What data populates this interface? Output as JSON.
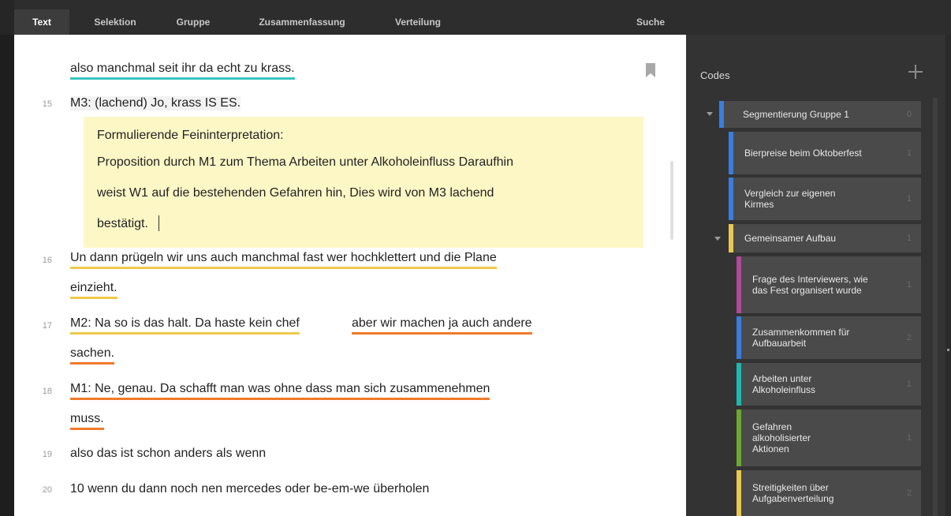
{
  "tabs": {
    "text": "Text",
    "selektion": "Selektion",
    "gruppe": "Gruppe",
    "zusammenfassung": "Zusammenfassung",
    "verteilung": "Verteilung",
    "suche": "Suche"
  },
  "transcript": {
    "line_prev": "also manchmal seit ihr da echt zu krass.",
    "line15_num": "15",
    "line15": "M3: (lachend) Jo, krass IS ES.",
    "memo_title": "Formulierende Feininterpretation:",
    "memo_line1": "Proposition durch M1 zum Thema Arbeiten unter Alkoholeinfluss Daraufhin",
    "memo_line2": "weist W1 auf die bestehenden Gefahren hin, Dies wird von M3 lachend",
    "memo_line3": "bestätigt.",
    "line16_num": "16",
    "line16a": "Un dann prügeln wir uns auch manchmal fast wer hochklettert und die Plane",
    "line16b": "einzieht.",
    "line17_num": "17",
    "line17a_part1": "M2: Na so is das halt. Da haste kein chef",
    "line17a_part2": "aber wir machen ja auch andere",
    "line17b": "sachen.",
    "line18_num": "18",
    "line18a": "M1: Ne, genau. Da schafft man was ohne dass man sich zusammenehmen",
    "line18b": "muss.",
    "line19_num": "19",
    "line19": "also das ist schon anders als wenn",
    "line20_num": "20",
    "line20": "10 wenn du dann noch nen mercedes oder be-em-we überholen"
  },
  "codes": {
    "title": "Codes",
    "items": [
      {
        "label": "Segmentierung Gruppe 1",
        "count": "0",
        "color": "#3a7de0"
      },
      {
        "label": "Bierpreise beim Oktoberfest",
        "count": "1",
        "color": "#3a7de0"
      },
      {
        "label": "Vergleich zur eigenen Kirmes",
        "count": "1",
        "color": "#3a7de0"
      },
      {
        "label": "Gemeinsamer Aufbau",
        "count": "1",
        "color": "#e8c850"
      },
      {
        "label": "Frage des Interviewers, wie das Fest organisert wurde",
        "count": "1",
        "color": "#b04a9a"
      },
      {
        "label": "Zusammenkommen für Aufbauarbeit",
        "count": "2",
        "color": "#3a7de0"
      },
      {
        "label": "Arbeiten unter Alkoholeinfluss",
        "count": "1",
        "color": "#1fb8b0"
      },
      {
        "label": "Gefahren alkoholisierter Aktionen",
        "count": "1",
        "color": "#6aa830"
      },
      {
        "label": "Streitigkeiten über Aufgabenverteilung",
        "count": "2",
        "color": "#e8c850"
      }
    ]
  }
}
